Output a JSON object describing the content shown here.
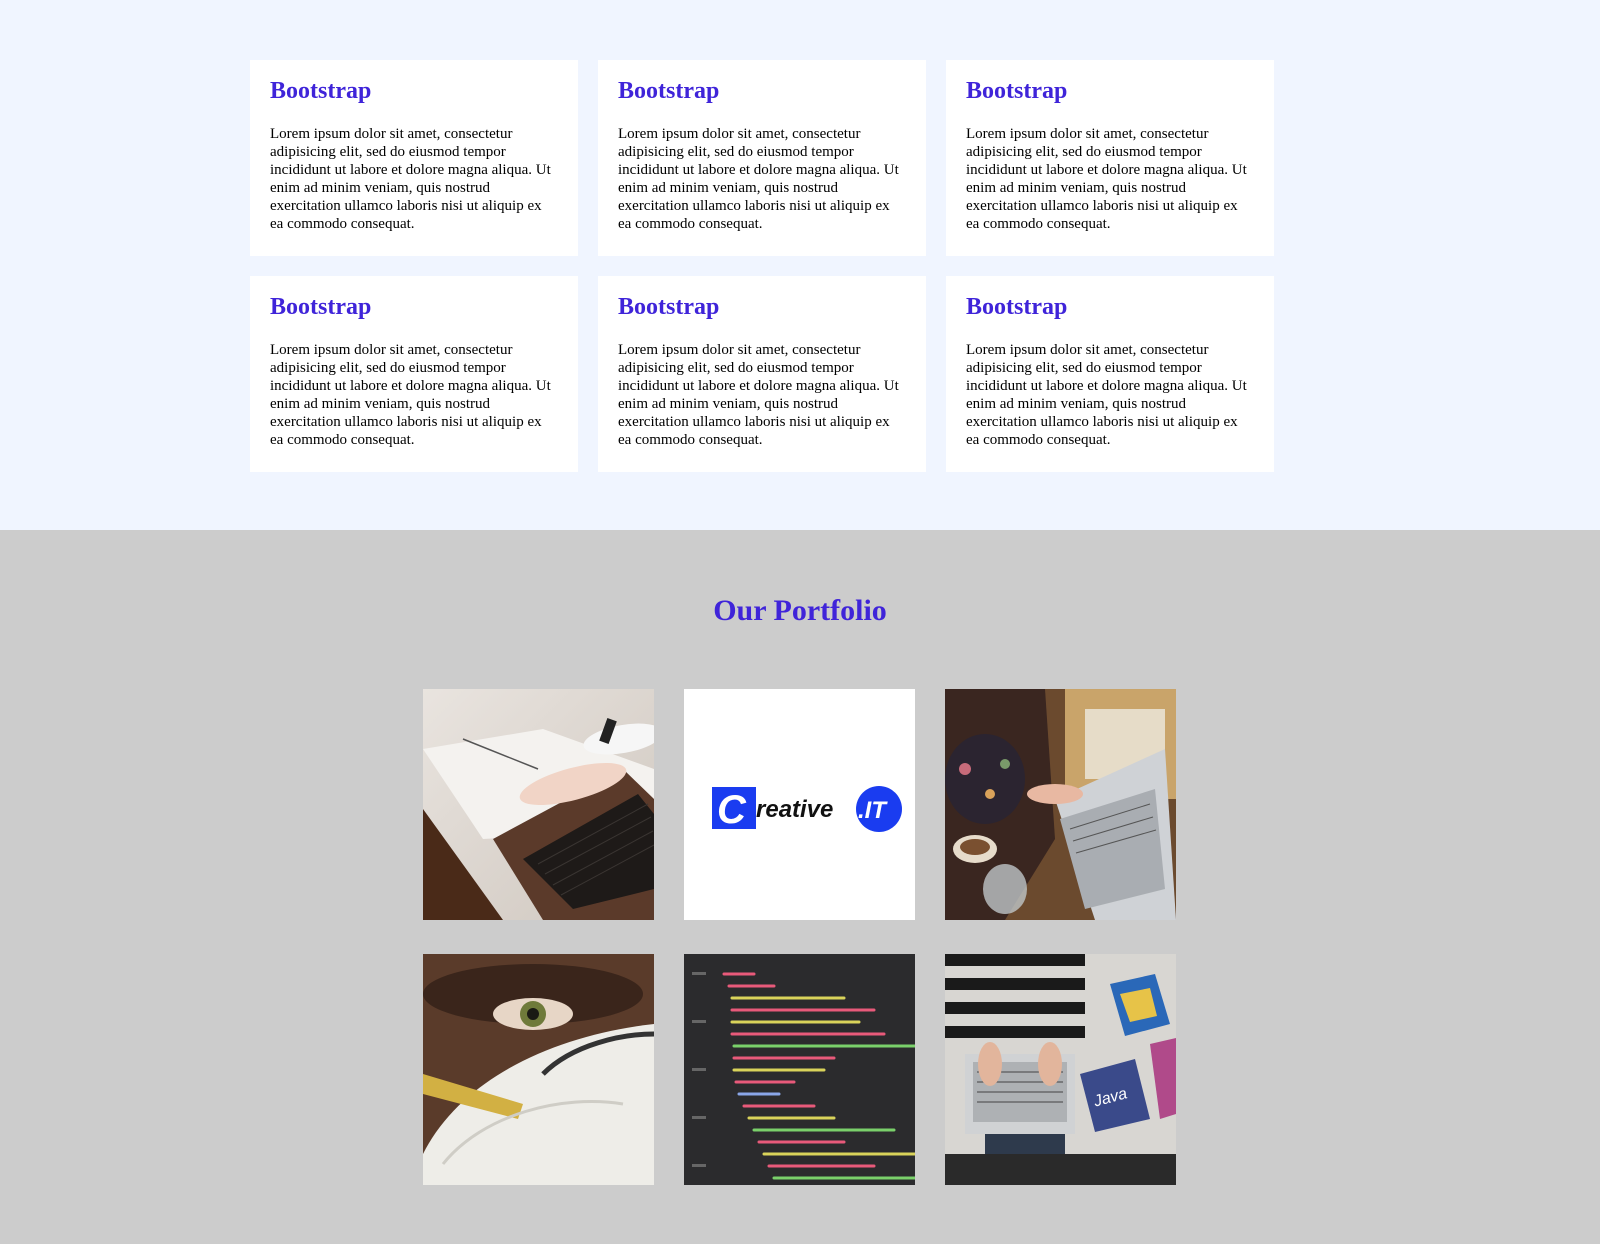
{
  "services": {
    "cards": [
      {
        "title": "Bootstrap",
        "text": "Lorem ipsum dolor sit amet, consectetur adipisicing elit, sed do eiusmod tempor incididunt ut labore et dolore magna aliqua. Ut enim ad minim veniam, quis nostrud exercitation ullamco laboris nisi ut aliquip ex ea commodo consequat."
      },
      {
        "title": "Bootstrap",
        "text": "Lorem ipsum dolor sit amet, consectetur adipisicing elit, sed do eiusmod tempor incididunt ut labore et dolore magna aliqua. Ut enim ad minim veniam, quis nostrud exercitation ullamco laboris nisi ut aliquip ex ea commodo consequat."
      },
      {
        "title": "Bootstrap",
        "text": "Lorem ipsum dolor sit amet, consectetur adipisicing elit, sed do eiusmod tempor incididunt ut labore et dolore magna aliqua. Ut enim ad minim veniam, quis nostrud exercitation ullamco laboris nisi ut aliquip ex ea commodo consequat."
      },
      {
        "title": "Bootstrap",
        "text": "Lorem ipsum dolor sit amet, consectetur adipisicing elit, sed do eiusmod tempor incididunt ut labore et dolore magna aliqua. Ut enim ad minim veniam, quis nostrud exercitation ullamco laboris nisi ut aliquip ex ea commodo consequat."
      },
      {
        "title": "Bootstrap",
        "text": "Lorem ipsum dolor sit amet, consectetur adipisicing elit, sed do eiusmod tempor incididunt ut labore et dolore magna aliqua. Ut enim ad minim veniam, quis nostrud exercitation ullamco laboris nisi ut aliquip ex ea commodo consequat."
      },
      {
        "title": "Bootstrap",
        "text": "Lorem ipsum dolor sit amet, consectetur adipisicing elit, sed do eiusmod tempor incididunt ut labore et dolore magna aliqua. Ut enim ad minim veniam, quis nostrud exercitation ullamco laboris nisi ut aliquip ex ea commodo consequat."
      }
    ]
  },
  "portfolio": {
    "heading": "Our Portfolio",
    "logo_text": "Creative.IT",
    "images": [
      "laptop-typing-photo",
      "creative-it-logo",
      "woman-laptop-coffee-photo",
      "face-mask-photo",
      "code-screen-photo",
      "laptop-books-photo"
    ]
  },
  "colors": {
    "accent": "#3f24d9",
    "services_bg": "#f0f5ff",
    "portfolio_bg": "#cccccc",
    "logo_blue": "#1a3cf0"
  }
}
